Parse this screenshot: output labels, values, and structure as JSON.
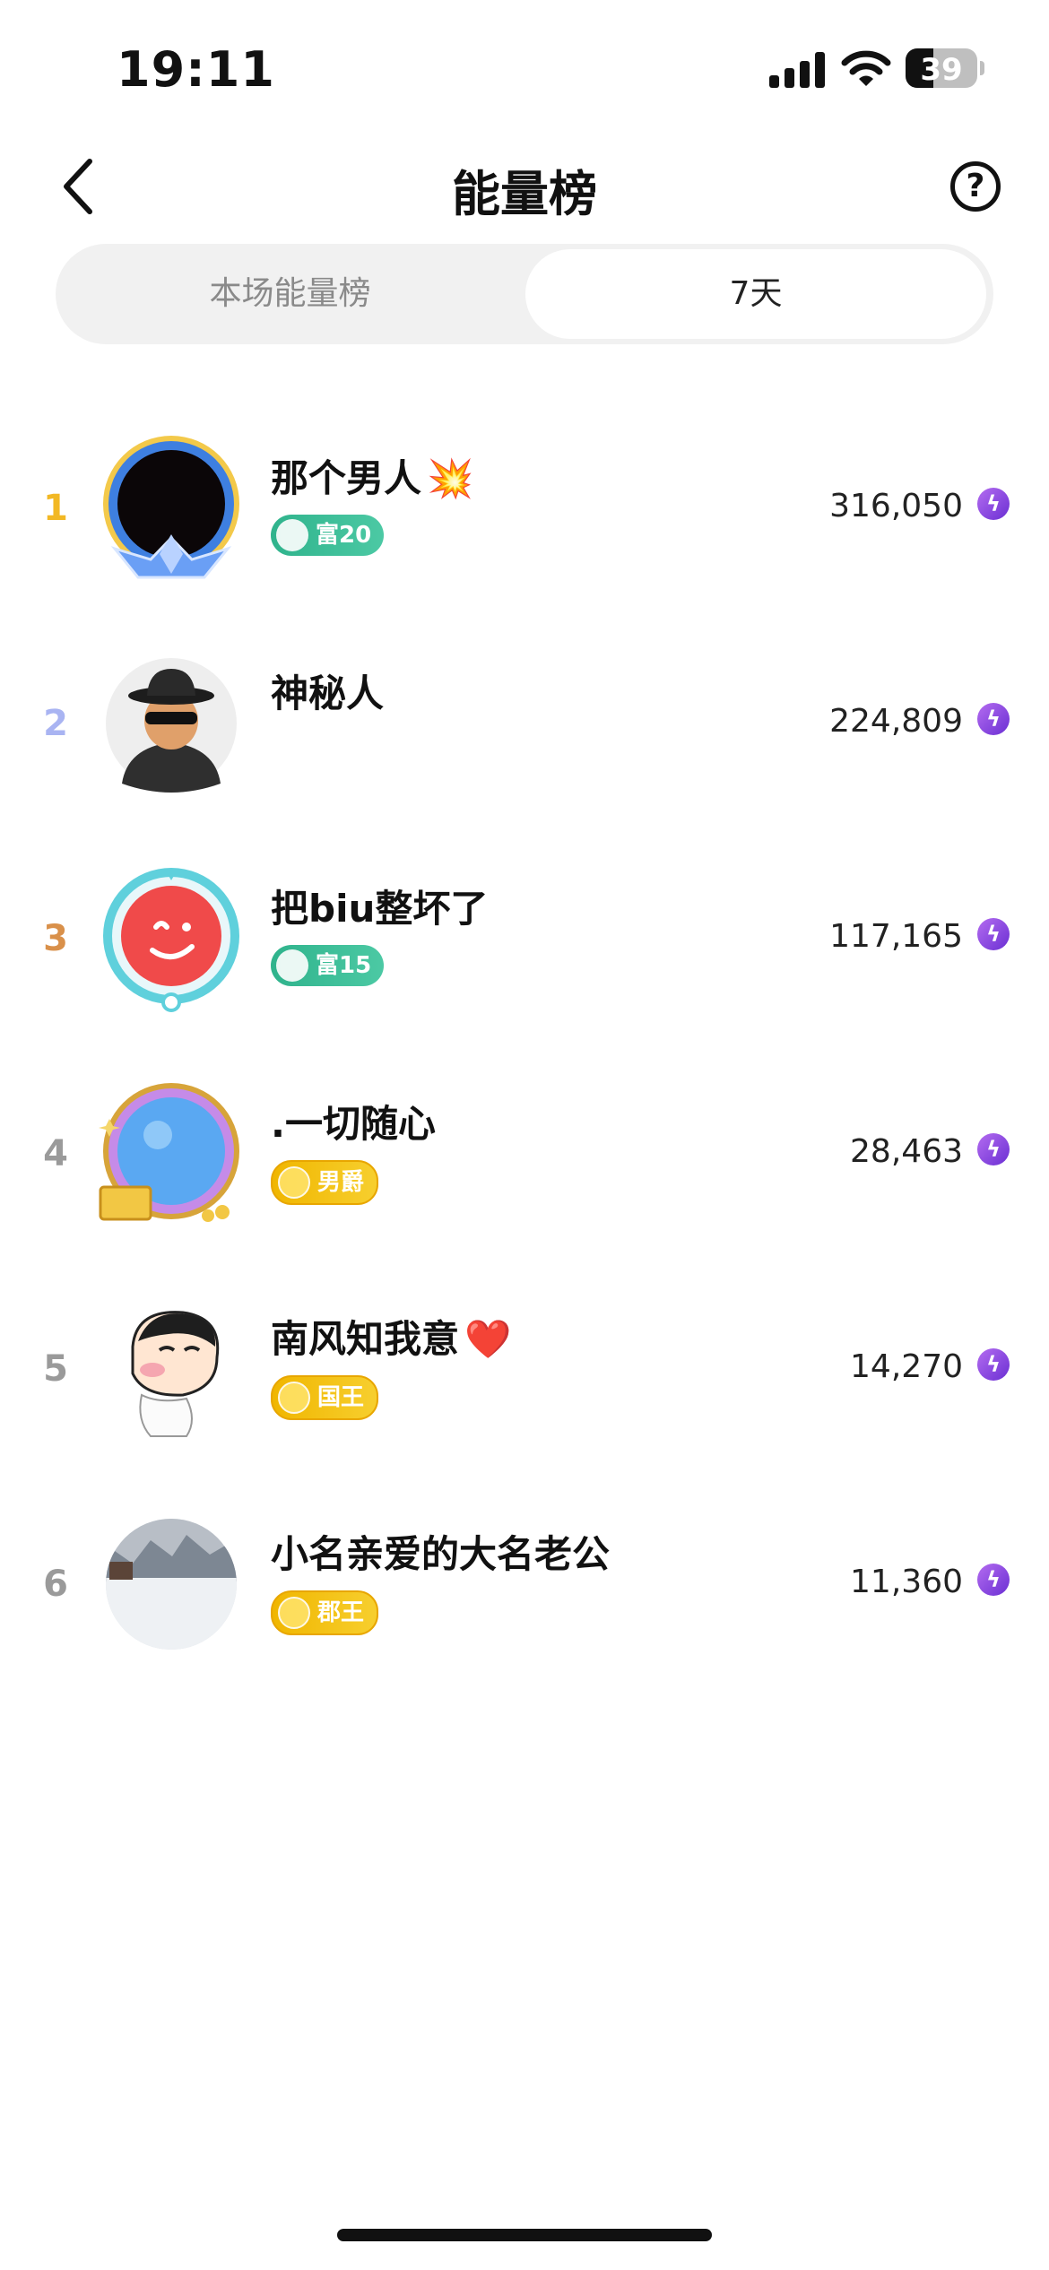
{
  "status_bar": {
    "time": "19:11",
    "battery_percent": "39",
    "battery_level": 0.39,
    "signal_bars": 4
  },
  "header": {
    "title": "能量榜",
    "back_icon": "chevron-left-icon",
    "help_icon": "question-circle-icon",
    "help_symbol": "?"
  },
  "tabs": [
    {
      "label": "本场能量榜",
      "selected": false
    },
    {
      "label": "7天",
      "selected": true
    }
  ],
  "ranking": [
    {
      "rank": "1",
      "rank_color": "#f2b824",
      "name": "那个男人",
      "emoji": "💥",
      "badge": "富20",
      "badge_style": "green",
      "score": "316,050"
    },
    {
      "rank": "2",
      "rank_color": "#a9b4f2",
      "name": "神秘人",
      "emoji": "",
      "badge": "",
      "badge_style": "",
      "score": "224,809"
    },
    {
      "rank": "3",
      "rank_color": "#d9904a",
      "name": "把biu整坏了",
      "emoji": "",
      "badge": "富15",
      "badge_style": "green",
      "score": "117,165"
    },
    {
      "rank": "4",
      "rank_color": "#9a9a9a",
      "name": ".一切随心",
      "emoji": "",
      "badge": "男爵",
      "badge_style": "gold",
      "score": "28,463"
    },
    {
      "rank": "5",
      "rank_color": "#9a9a9a",
      "name": "南风知我意",
      "emoji": "❤️",
      "badge": "国王",
      "badge_style": "gold",
      "score": "14,270"
    },
    {
      "rank": "6",
      "rank_color": "#9a9a9a",
      "name": "小名亲爱的大名老公",
      "emoji": "",
      "badge": "郡王",
      "badge_style": "gold",
      "score": "11,360"
    }
  ],
  "energy_icon": "lightning-icon",
  "energy_symbol": "ϟ",
  "colors": {
    "accent_purple": "#7b3ae0",
    "badge_green": "#2fb38c",
    "badge_gold": "#f0b600"
  }
}
